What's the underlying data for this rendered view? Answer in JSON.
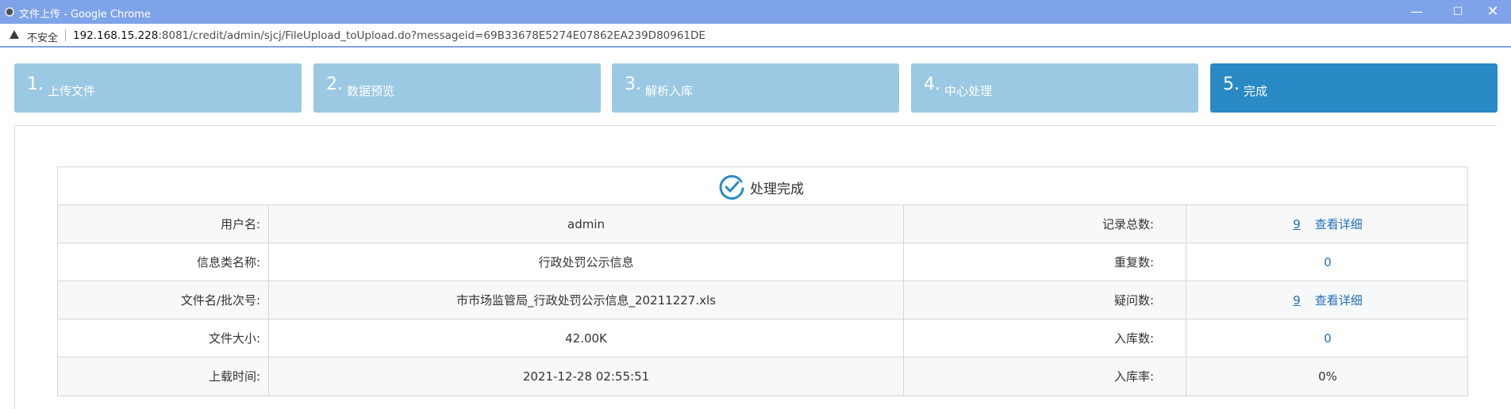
{
  "window": {
    "title": "文件上传 - Google Chrome",
    "controls": {
      "minimize": "—",
      "maximize": "☐",
      "close": "✕"
    }
  },
  "addressbar": {
    "security_label": "不安全",
    "url_host": "192.168.15.228",
    "url_rest": ":8081/credit/admin/sjcj/FileUpload_toUpload.do?messageid=69B33678E5274E07862EA239D80961DE"
  },
  "steps": [
    {
      "num": "1.",
      "label": "上传文件"
    },
    {
      "num": "2.",
      "label": "数据预览"
    },
    {
      "num": "3.",
      "label": "解析入库"
    },
    {
      "num": "4.",
      "label": "中心处理"
    },
    {
      "num": "5.",
      "label": "完成"
    }
  ],
  "active_step": 5,
  "result": {
    "title": "处理完成",
    "rows": [
      {
        "label": "用户名:",
        "value": "admin",
        "label2": "记录总数:",
        "value2": "9",
        "detail": "查看详细"
      },
      {
        "label": "信息类名称:",
        "value": "行政处罚公示信息",
        "label2": "重复数:",
        "value2": "0"
      },
      {
        "label": "文件名/批次号:",
        "value": "市市场监管局_行政处罚公示信息_20211227.xls",
        "label2": "疑问数:",
        "value2": "9",
        "detail": "查看详细"
      },
      {
        "label": "文件大小:",
        "value": "42.00K",
        "label2": "入库数:",
        "value2": "0"
      },
      {
        "label": "上载时间:",
        "value": "2021-12-28 02:55:51",
        "label2": "入库率:",
        "value2": "0%"
      }
    ]
  },
  "colors": {
    "titlebar": "#7ea3e8",
    "step_inactive": "#9bc8e3",
    "step_active": "#2a8ac6",
    "link": "#1f6fb8"
  }
}
